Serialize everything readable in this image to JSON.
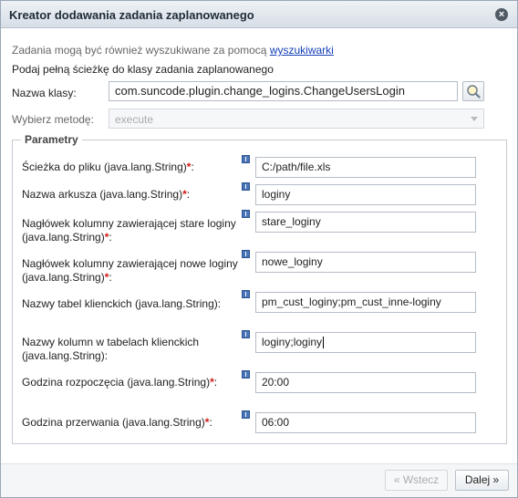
{
  "dialog": {
    "title": "Kreator dodawania zadania zaplanowanego",
    "close_icon": "close-icon"
  },
  "hints": {
    "search_text": "Zadania mogą być również wyszukiwane za pomocą ",
    "search_link": "wyszukiwarki",
    "class_path_hint": "Podaj pełną ścieżkę do klasy zadania zaplanowanego"
  },
  "class_name": {
    "label": "Nazwa klasy:",
    "value": "com.suncode.plugin.change_logins.ChangeUsersLogin",
    "search_icon": "search-icon"
  },
  "method": {
    "label": "Wybierz metodę:",
    "value": "execute"
  },
  "parameters": {
    "legend": "Parametry",
    "required_mark": "*",
    "items": [
      {
        "label": "Ścieżka do pliku (java.lang.String)",
        "suffix": ":",
        "required": true,
        "value": "C:/path/file.xls"
      },
      {
        "label": "Nazwa arkusza (java.lang.String)",
        "suffix": ":",
        "required": true,
        "value": "loginy"
      },
      {
        "label": "Nagłówek kolumny zawierającej stare loginy (java.lang.String)",
        "suffix": ":",
        "required": true,
        "value": "stare_loginy"
      },
      {
        "label": "Nagłówek kolumny zawierającej nowe loginy (java.lang.String)",
        "suffix": ":",
        "required": true,
        "value": "nowe_loginy"
      },
      {
        "label": "Nazwy tabel klienckich (java.lang.String):",
        "suffix": "",
        "required": false,
        "value": "pm_cust_loginy;pm_cust_inne-loginy"
      },
      {
        "label": "Nazwy kolumn w tabelach klienckich (java.lang.String):",
        "suffix": "",
        "required": false,
        "value": "loginy;loginy"
      },
      {
        "label": "Godzina rozpoczęcia (java.lang.String)",
        "suffix": ":",
        "required": true,
        "value": "20:00"
      },
      {
        "label": "Godzina przerwania (java.lang.String)",
        "suffix": ":",
        "required": true,
        "value": "06:00"
      }
    ]
  },
  "footer": {
    "back_label": "« Wstecz",
    "next_label": "Dalej »"
  }
}
